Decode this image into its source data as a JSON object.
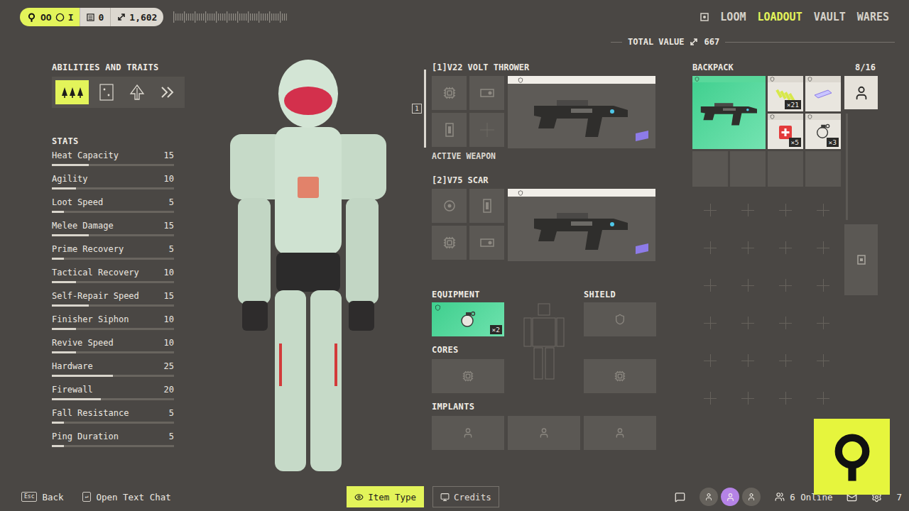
{
  "top_bar": {
    "player": {
      "name": "OO",
      "rank": "I"
    },
    "counters": [
      {
        "kind": "list",
        "value": "0"
      },
      {
        "kind": "currency",
        "value": "1,602"
      }
    ],
    "nav": [
      {
        "label": "LOOM",
        "selected": false
      },
      {
        "label": "LOADOUT",
        "selected": true
      },
      {
        "label": "VAULT",
        "selected": false
      },
      {
        "label": "WARES",
        "selected": false
      }
    ]
  },
  "total_value": {
    "label": "TOTAL VALUE",
    "value": "667"
  },
  "abilities": {
    "title": "ABILITIES AND TRAITS",
    "items": [
      {
        "kind": "trees",
        "selected": true
      },
      {
        "kind": "dots",
        "selected": false
      },
      {
        "kind": "arrows",
        "selected": false
      },
      {
        "kind": "chevrons",
        "selected": false
      }
    ]
  },
  "stats": {
    "title": "STATS",
    "items": [
      {
        "name": "Heat Capacity",
        "value": "15",
        "level": 0.3
      },
      {
        "name": "Agility",
        "value": "10",
        "level": 0.2
      },
      {
        "name": "Loot Speed",
        "value": "5",
        "level": 0.1
      },
      {
        "name": "Melee Damage",
        "value": "15",
        "level": 0.3
      },
      {
        "name": "Prime Recovery",
        "value": "5",
        "level": 0.1
      },
      {
        "name": "Tactical Recovery",
        "value": "10",
        "level": 0.2
      },
      {
        "name": "Self-Repair Speed",
        "value": "15",
        "level": 0.3
      },
      {
        "name": "Finisher Siphon",
        "value": "10",
        "level": 0.2
      },
      {
        "name": "Revive Speed",
        "value": "10",
        "level": 0.2
      },
      {
        "name": "Hardware",
        "value": "25",
        "level": 0.5
      },
      {
        "name": "Firewall",
        "value": "20",
        "level": 0.4
      },
      {
        "name": "Fall Resistance",
        "value": "5",
        "level": 0.1
      },
      {
        "name": "Ping Duration",
        "value": "5",
        "level": 0.1
      }
    ]
  },
  "weapons": [
    {
      "slot": "[1]",
      "name": "V22 VOLT THROWER",
      "active": true,
      "badge": "1",
      "status": "ACTIVE WEAPON",
      "mods": [
        {
          "kind": "chip"
        },
        {
          "kind": "scope"
        },
        {
          "kind": "mag"
        },
        {
          "kind": "empty"
        }
      ]
    },
    {
      "slot": "[2]",
      "name": "V75 SCAR",
      "active": false,
      "mods": [
        {
          "kind": "barrel"
        },
        {
          "kind": "mag"
        },
        {
          "kind": "chip"
        },
        {
          "kind": "scope"
        }
      ]
    }
  ],
  "equipment": {
    "title": "EQUIPMENT",
    "count": "×2"
  },
  "shield": {
    "title": "SHIELD"
  },
  "cores": {
    "title": "CORES",
    "slots": [
      {
        "filled": false
      },
      {
        "filled": false
      }
    ]
  },
  "implants": {
    "title": "IMPLANTS",
    "slots": [
      {
        "filled": false
      },
      {
        "filled": false
      },
      {
        "filled": false
      }
    ]
  },
  "backpack": {
    "title": "BACKPACK",
    "capacity": "8/16",
    "items": [
      {
        "kind": "weapon"
      },
      {
        "kind": "ammo",
        "count": "×21"
      },
      {
        "kind": "mod"
      },
      {
        "kind": "medkit",
        "count": "×5"
      },
      {
        "kind": "grenade",
        "count": "×3"
      }
    ],
    "empty_slots": [
      {
        "filled": false
      },
      {
        "filled": false
      },
      {
        "filled": false
      },
      {
        "filled": false
      }
    ]
  },
  "bottom_bar": {
    "hints": [
      {
        "key": "Esc",
        "label": "Back"
      },
      {
        "key": "↵",
        "label": "Open Text Chat"
      }
    ],
    "filters": [
      {
        "kind": "eye",
        "label": "Item Type",
        "selected": true
      },
      {
        "kind": "monitor",
        "label": "Credits",
        "selected": false
      }
    ],
    "online": "6 Online",
    "notifications": "7"
  }
}
